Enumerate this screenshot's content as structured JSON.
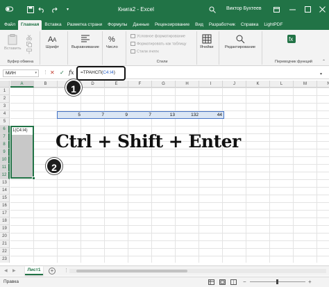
{
  "window": {
    "title": "Книга2 - Excel",
    "user": "Виктор Бухтеев",
    "accent_color": "#217346"
  },
  "tabs": [
    "Файл",
    "Главная",
    "Вставка",
    "Разметка страни",
    "Формулы",
    "Данные",
    "Рецензирование",
    "Вид",
    "Разработчик",
    "Справка",
    "LightPDF"
  ],
  "active_tab": "Главная",
  "ribbon": {
    "clipboard": {
      "paste": "Вставить",
      "group": "Буфер обмена"
    },
    "font": {
      "label": "Шрифт"
    },
    "alignment": {
      "label": "Выравнивание"
    },
    "number": {
      "label": "Число"
    },
    "styles": {
      "conditional": "Условное форматирование",
      "as_table": "Форматировать как таблицу",
      "cell_styles": "Стили ячеек",
      "group": "Стили"
    },
    "cells": {
      "label": "Ячейки"
    },
    "editing": {
      "label": "Редактирование"
    },
    "translator": {
      "group": "Переводчик функций"
    }
  },
  "formula_bar": {
    "name_box": "МИН",
    "cancel_symbol": "✕",
    "enter_symbol": "✓",
    "fx_symbol": "fx",
    "formula_prefix": "=ТРАНСП(",
    "formula_ref": "C4:I4",
    "formula_suffix": ")"
  },
  "grid": {
    "columns": [
      "A",
      "B",
      "C",
      "D",
      "E",
      "F",
      "G",
      "H",
      "I",
      "J",
      "K",
      "L",
      "M",
      "N"
    ],
    "rows": [
      "1",
      "2",
      "3",
      "4",
      "5",
      "6",
      "7",
      "8",
      "9",
      "10",
      "11",
      "12",
      "13",
      "14",
      "15",
      "16",
      "17",
      "18",
      "19",
      "20",
      "21",
      "22",
      "23"
    ],
    "row4_values": [
      "5",
      "7",
      "9",
      "7",
      "13",
      "132",
      "44"
    ],
    "a6_text": "1(C4:I4)"
  },
  "overlay": {
    "shortcut": "Ctrl + Shift + Enter",
    "step1": "1",
    "step2": "2"
  },
  "sheets": {
    "active": "Лист1",
    "add_symbol": "+"
  },
  "status": {
    "mode": "Правка"
  }
}
